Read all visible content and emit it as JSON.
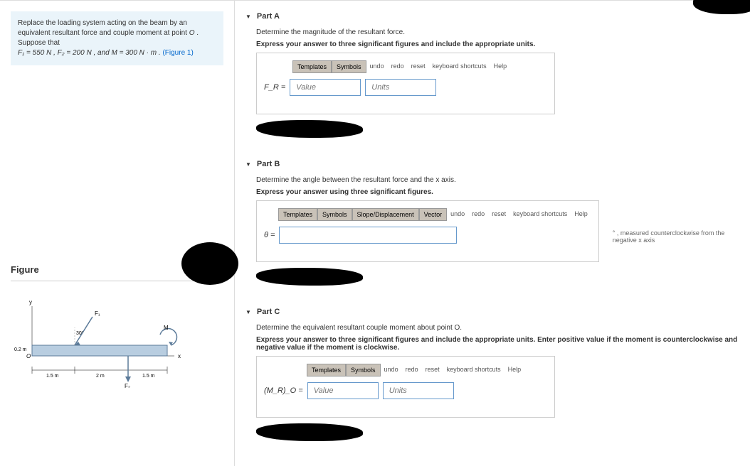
{
  "problem": {
    "text1": "Replace the loading system acting on the beam by an equivalent resultant force and couple moment at point ",
    "pointO": "O",
    "text2": ". Suppose that",
    "eq": "F₁ = 550 N , F₂ = 200 N , and M = 300 N · m . ",
    "figref": "(Figure 1)"
  },
  "figure": {
    "label": "Figure"
  },
  "figdims": {
    "h": "0.2 m",
    "d1": "1.5 m",
    "d2": "2 m",
    "d3": "1.5 m",
    "angle": "30°",
    "F1": "F₁",
    "F2": "F₂",
    "M": "M",
    "O": "O",
    "x": "x",
    "y": "y"
  },
  "partA": {
    "title": "Part A",
    "instr1": "Determine the magnitude of the resultant force.",
    "instr2": "Express your answer to three significant figures and include the appropriate units.",
    "var": "F_R =",
    "valuePh": "Value",
    "unitsPh": "Units"
  },
  "partB": {
    "title": "Part B",
    "instr1": "Determine the angle between the resultant force and the x axis.",
    "instr2": "Express your answer using three significant figures.",
    "var": "θ =",
    "hint": "° , measured counterclockwise from the negative x axis"
  },
  "partC": {
    "title": "Part C",
    "instr1": "Determine the equivalent resultant couple moment about point O.",
    "instr2": "Express your answer to three significant figures and include the appropriate units. Enter positive value if the moment is counterclockwise and negative value if the moment is clockwise.",
    "var": "(M_R)_O =",
    "valuePh": "Value",
    "unitsPh": "Units"
  },
  "toolbar": {
    "templates": "Templates",
    "symbols": "Symbols",
    "slope": "Slope/Displacement",
    "vector": "Vector",
    "undo": "undo",
    "redo": "redo",
    "reset": "reset",
    "kb": "keyboard shortcuts",
    "help": "Help"
  }
}
